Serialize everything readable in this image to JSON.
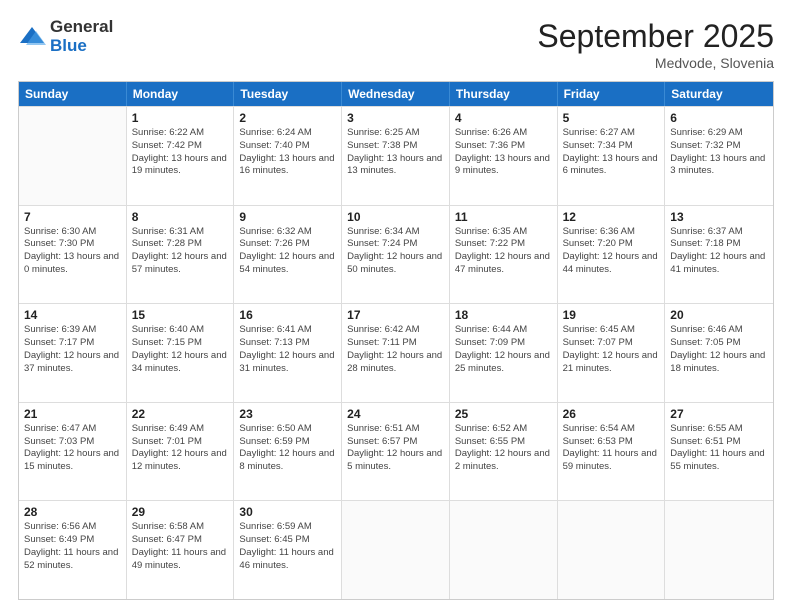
{
  "logo": {
    "general": "General",
    "blue": "Blue"
  },
  "title": "September 2025",
  "location": "Medvode, Slovenia",
  "header_days": [
    "Sunday",
    "Monday",
    "Tuesday",
    "Wednesday",
    "Thursday",
    "Friday",
    "Saturday"
  ],
  "weeks": [
    [
      {
        "day": "",
        "empty": true
      },
      {
        "day": "1",
        "sunrise": "Sunrise: 6:22 AM",
        "sunset": "Sunset: 7:42 PM",
        "daylight": "Daylight: 13 hours and 19 minutes."
      },
      {
        "day": "2",
        "sunrise": "Sunrise: 6:24 AM",
        "sunset": "Sunset: 7:40 PM",
        "daylight": "Daylight: 13 hours and 16 minutes."
      },
      {
        "day": "3",
        "sunrise": "Sunrise: 6:25 AM",
        "sunset": "Sunset: 7:38 PM",
        "daylight": "Daylight: 13 hours and 13 minutes."
      },
      {
        "day": "4",
        "sunrise": "Sunrise: 6:26 AM",
        "sunset": "Sunset: 7:36 PM",
        "daylight": "Daylight: 13 hours and 9 minutes."
      },
      {
        "day": "5",
        "sunrise": "Sunrise: 6:27 AM",
        "sunset": "Sunset: 7:34 PM",
        "daylight": "Daylight: 13 hours and 6 minutes."
      },
      {
        "day": "6",
        "sunrise": "Sunrise: 6:29 AM",
        "sunset": "Sunset: 7:32 PM",
        "daylight": "Daylight: 13 hours and 3 minutes."
      }
    ],
    [
      {
        "day": "7",
        "sunrise": "Sunrise: 6:30 AM",
        "sunset": "Sunset: 7:30 PM",
        "daylight": "Daylight: 13 hours and 0 minutes."
      },
      {
        "day": "8",
        "sunrise": "Sunrise: 6:31 AM",
        "sunset": "Sunset: 7:28 PM",
        "daylight": "Daylight: 12 hours and 57 minutes."
      },
      {
        "day": "9",
        "sunrise": "Sunrise: 6:32 AM",
        "sunset": "Sunset: 7:26 PM",
        "daylight": "Daylight: 12 hours and 54 minutes."
      },
      {
        "day": "10",
        "sunrise": "Sunrise: 6:34 AM",
        "sunset": "Sunset: 7:24 PM",
        "daylight": "Daylight: 12 hours and 50 minutes."
      },
      {
        "day": "11",
        "sunrise": "Sunrise: 6:35 AM",
        "sunset": "Sunset: 7:22 PM",
        "daylight": "Daylight: 12 hours and 47 minutes."
      },
      {
        "day": "12",
        "sunrise": "Sunrise: 6:36 AM",
        "sunset": "Sunset: 7:20 PM",
        "daylight": "Daylight: 12 hours and 44 minutes."
      },
      {
        "day": "13",
        "sunrise": "Sunrise: 6:37 AM",
        "sunset": "Sunset: 7:18 PM",
        "daylight": "Daylight: 12 hours and 41 minutes."
      }
    ],
    [
      {
        "day": "14",
        "sunrise": "Sunrise: 6:39 AM",
        "sunset": "Sunset: 7:17 PM",
        "daylight": "Daylight: 12 hours and 37 minutes."
      },
      {
        "day": "15",
        "sunrise": "Sunrise: 6:40 AM",
        "sunset": "Sunset: 7:15 PM",
        "daylight": "Daylight: 12 hours and 34 minutes."
      },
      {
        "day": "16",
        "sunrise": "Sunrise: 6:41 AM",
        "sunset": "Sunset: 7:13 PM",
        "daylight": "Daylight: 12 hours and 31 minutes."
      },
      {
        "day": "17",
        "sunrise": "Sunrise: 6:42 AM",
        "sunset": "Sunset: 7:11 PM",
        "daylight": "Daylight: 12 hours and 28 minutes."
      },
      {
        "day": "18",
        "sunrise": "Sunrise: 6:44 AM",
        "sunset": "Sunset: 7:09 PM",
        "daylight": "Daylight: 12 hours and 25 minutes."
      },
      {
        "day": "19",
        "sunrise": "Sunrise: 6:45 AM",
        "sunset": "Sunset: 7:07 PM",
        "daylight": "Daylight: 12 hours and 21 minutes."
      },
      {
        "day": "20",
        "sunrise": "Sunrise: 6:46 AM",
        "sunset": "Sunset: 7:05 PM",
        "daylight": "Daylight: 12 hours and 18 minutes."
      }
    ],
    [
      {
        "day": "21",
        "sunrise": "Sunrise: 6:47 AM",
        "sunset": "Sunset: 7:03 PM",
        "daylight": "Daylight: 12 hours and 15 minutes."
      },
      {
        "day": "22",
        "sunrise": "Sunrise: 6:49 AM",
        "sunset": "Sunset: 7:01 PM",
        "daylight": "Daylight: 12 hours and 12 minutes."
      },
      {
        "day": "23",
        "sunrise": "Sunrise: 6:50 AM",
        "sunset": "Sunset: 6:59 PM",
        "daylight": "Daylight: 12 hours and 8 minutes."
      },
      {
        "day": "24",
        "sunrise": "Sunrise: 6:51 AM",
        "sunset": "Sunset: 6:57 PM",
        "daylight": "Daylight: 12 hours and 5 minutes."
      },
      {
        "day": "25",
        "sunrise": "Sunrise: 6:52 AM",
        "sunset": "Sunset: 6:55 PM",
        "daylight": "Daylight: 12 hours and 2 minutes."
      },
      {
        "day": "26",
        "sunrise": "Sunrise: 6:54 AM",
        "sunset": "Sunset: 6:53 PM",
        "daylight": "Daylight: 11 hours and 59 minutes."
      },
      {
        "day": "27",
        "sunrise": "Sunrise: 6:55 AM",
        "sunset": "Sunset: 6:51 PM",
        "daylight": "Daylight: 11 hours and 55 minutes."
      }
    ],
    [
      {
        "day": "28",
        "sunrise": "Sunrise: 6:56 AM",
        "sunset": "Sunset: 6:49 PM",
        "daylight": "Daylight: 11 hours and 52 minutes."
      },
      {
        "day": "29",
        "sunrise": "Sunrise: 6:58 AM",
        "sunset": "Sunset: 6:47 PM",
        "daylight": "Daylight: 11 hours and 49 minutes."
      },
      {
        "day": "30",
        "sunrise": "Sunrise: 6:59 AM",
        "sunset": "Sunset: 6:45 PM",
        "daylight": "Daylight: 11 hours and 46 minutes."
      },
      {
        "day": "",
        "empty": true
      },
      {
        "day": "",
        "empty": true
      },
      {
        "day": "",
        "empty": true
      },
      {
        "day": "",
        "empty": true
      }
    ]
  ]
}
